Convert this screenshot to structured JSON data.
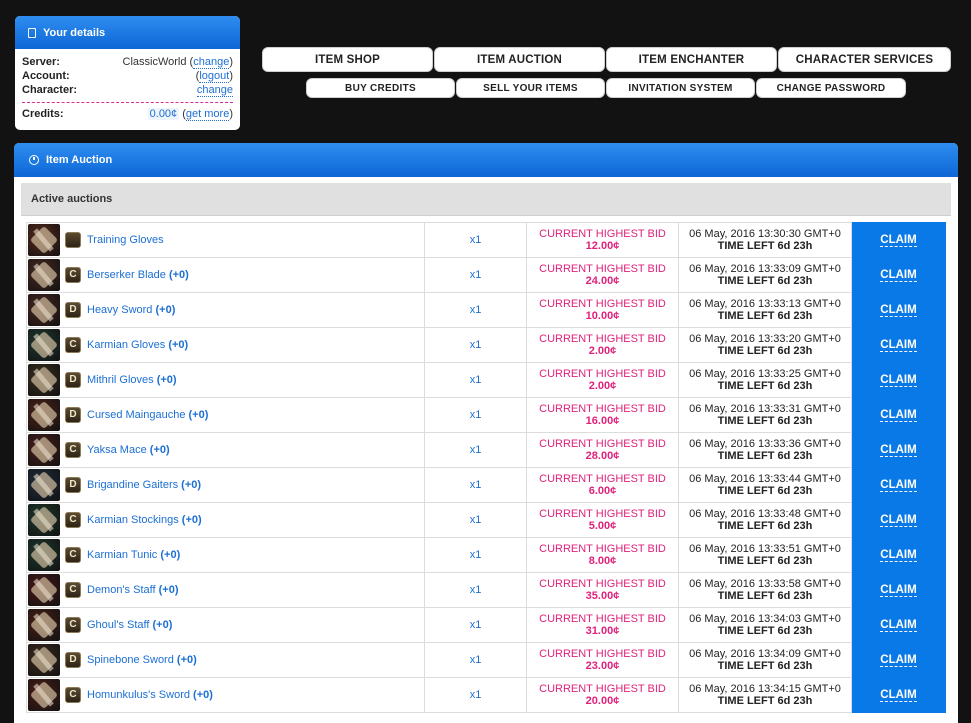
{
  "details": {
    "title": "Your details",
    "server_label": "Server:",
    "server_value": "ClassicWorld",
    "server_link": "change",
    "account_label": "Account:",
    "account_link": "logout",
    "character_label": "Character:",
    "character_link": "change",
    "credits_label": "Credits:",
    "credits_value": "0.00¢",
    "credits_link": "get more"
  },
  "nav": {
    "row1": [
      "ITEM SHOP",
      "ITEM AUCTION",
      "ITEM ENCHANTER",
      "CHARACTER SERVICES"
    ],
    "row2": [
      "BUY CREDITS",
      "SELL YOUR ITEMS",
      "INVITATION SYSTEM",
      "CHANGE PASSWORD"
    ]
  },
  "auction": {
    "title": "Item Auction",
    "subtitle": "Active auctions",
    "bid_label": "CURRENT HIGHEST BID",
    "time_left": "TIME LEFT 6d 23h",
    "claim_label": "CLAIM",
    "rows": [
      {
        "name": "Training Gloves",
        "enchant": "",
        "grade": "",
        "qty": "x1",
        "bid": "12.00¢",
        "date": "06 May, 2016 13:30:30 GMT+0",
        "color": "#5a2a1c"
      },
      {
        "name": "Berserker Blade",
        "enchant": "(+0)",
        "grade": "C",
        "qty": "x1",
        "bid": "24.00¢",
        "date": "06 May, 2016 13:33:09 GMT+0",
        "color": "#4a2a22"
      },
      {
        "name": "Heavy Sword",
        "enchant": "(+0)",
        "grade": "D",
        "qty": "x1",
        "bid": "10.00¢",
        "date": "06 May, 2016 13:33:13 GMT+0",
        "color": "#4a2620"
      },
      {
        "name": "Karmian Gloves",
        "enchant": "(+0)",
        "grade": "C",
        "qty": "x1",
        "bid": "2.00¢",
        "date": "06 May, 2016 13:33:20 GMT+0",
        "color": "#1f3a30"
      },
      {
        "name": "Mithril Gloves",
        "enchant": "(+0)",
        "grade": "D",
        "qty": "x1",
        "bid": "2.00¢",
        "date": "06 May, 2016 13:33:25 GMT+0",
        "color": "#3a3020"
      },
      {
        "name": "Cursed Maingauche",
        "enchant": "(+0)",
        "grade": "D",
        "qty": "x1",
        "bid": "16.00¢",
        "date": "06 May, 2016 13:33:31 GMT+0",
        "color": "#4e2418"
      },
      {
        "name": "Yaksa Mace",
        "enchant": "(+0)",
        "grade": "C",
        "qty": "x1",
        "bid": "28.00¢",
        "date": "06 May, 2016 13:33:36 GMT+0",
        "color": "#4a1f1a"
      },
      {
        "name": "Brigandine Gaiters",
        "enchant": "(+0)",
        "grade": "D",
        "qty": "x1",
        "bid": "6.00¢",
        "date": "06 May, 2016 13:33:44 GMT+0",
        "color": "#1f2d3e"
      },
      {
        "name": "Karmian Stockings",
        "enchant": "(+0)",
        "grade": "C",
        "qty": "x1",
        "bid": "5.00¢",
        "date": "06 May, 2016 13:33:48 GMT+0",
        "color": "#1c3a2c"
      },
      {
        "name": "Karmian Tunic",
        "enchant": "(+0)",
        "grade": "C",
        "qty": "x1",
        "bid": "8.00¢",
        "date": "06 May, 2016 13:33:51 GMT+0",
        "color": "#1e3a2e"
      },
      {
        "name": "Demon's Staff",
        "enchant": "(+0)",
        "grade": "C",
        "qty": "x1",
        "bid": "35.00¢",
        "date": "06 May, 2016 13:33:58 GMT+0",
        "color": "#4a1818"
      },
      {
        "name": "Ghoul's Staff",
        "enchant": "(+0)",
        "grade": "C",
        "qty": "x1",
        "bid": "31.00¢",
        "date": "06 May, 2016 13:34:03 GMT+0",
        "color": "#4a2016"
      },
      {
        "name": "Spinebone Sword",
        "enchant": "(+0)",
        "grade": "D",
        "qty": "x1",
        "bid": "23.00¢",
        "date": "06 May, 2016 13:34:09 GMT+0",
        "color": "#3e2a1e"
      },
      {
        "name": "Homunkulus's Sword",
        "enchant": "(+0)",
        "grade": "C",
        "qty": "x1",
        "bid": "20.00¢",
        "date": "06 May, 2016 13:34:15 GMT+0",
        "color": "#4c1e18"
      }
    ]
  }
}
